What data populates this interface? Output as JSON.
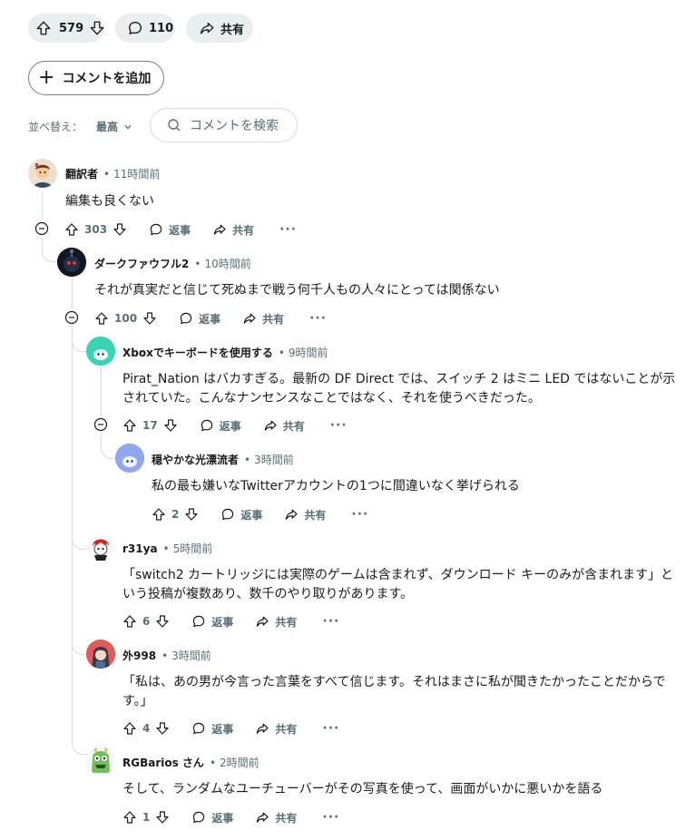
{
  "post_bar": {
    "score": "579",
    "comments": "110",
    "share": "共有"
  },
  "add_comment": "コメントを追加",
  "sort": {
    "label": "並べ替え：",
    "value": "最高"
  },
  "search": {
    "placeholder": "コメントを検索"
  },
  "colors": {
    "pill_bg": "#e9eef1",
    "meta_gray": "#576f76",
    "thread_line": "#d5dadc"
  },
  "comments": [
    {
      "author": "翻訳者",
      "time": "11時間前",
      "text": "編集も良くない",
      "score": "303",
      "reply": "返事",
      "share": "共有",
      "avatar": "cartoon-boy-avatar"
    },
    {
      "author": "ダークファウフル2",
      "time": "10時間前",
      "text": "それが真実だと信じて死ぬまで戦う何千人もの人々にとっては関係ない",
      "score": "100",
      "reply": "返事",
      "share": "共有",
      "avatar": "dark-robot-avatar"
    },
    {
      "author": "Xboxでキーボードを使用する",
      "time": "9時間前",
      "text": "Pirat_Nation はバカすぎる。最新の DF Direct では、スイッチ 2 はミニ LED ではないことが示されていた。こんなナンセンスなことではなく、それを使うべきだった。",
      "score": "17",
      "reply": "返事",
      "share": "共有",
      "avatar": "teal-snoo-avatar"
    },
    {
      "author": "穏やかな光漂流者",
      "time": "3時間前",
      "text": "私の最も嫌いなTwitterアカウントの1つに間違いなく挙げられる",
      "score": "2",
      "reply": "返事",
      "share": "共有",
      "avatar": "blue-snoo-avatar"
    },
    {
      "author": "r31ya",
      "time": "5時間前",
      "text": "「switch2 カートリッジには実際のゲームは含まれず、ダウンロード キーのみが含まれます」という投稿が複数あり、数千のやり取りがあります。",
      "score": "6",
      "reply": "返事",
      "share": "共有",
      "avatar": "red-hair-avatar"
    },
    {
      "author": "外998",
      "time": "3時間前",
      "text": "「私は、あの男が今言った言葉をすべて信じます。それはまさに私が聞きたかったことだからです。」",
      "score": "4",
      "reply": "返事",
      "share": "共有",
      "avatar": "anime-girl-avatar"
    },
    {
      "author": "RGBarios さん",
      "time": "2時間前",
      "text": "そして、ランダムなユーチューバーがその写真を使って、画面がいかに悪いかを語る",
      "score": "1",
      "reply": "返事",
      "share": "共有",
      "avatar": "green-monster-avatar"
    }
  ]
}
